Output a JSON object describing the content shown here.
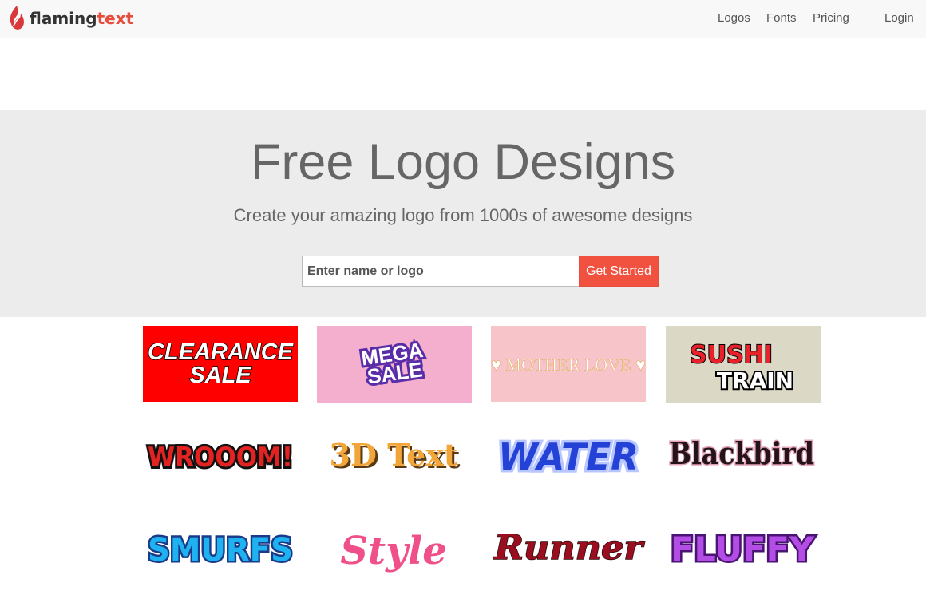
{
  "header": {
    "brand_part1": "flaming",
    "brand_part2": "text",
    "nav": [
      "Logos",
      "Fonts",
      "Pricing",
      "Login"
    ]
  },
  "hero": {
    "title": "Free Logo Designs",
    "subtitle": "Create your amazing logo from 1000s of awesome designs",
    "search_placeholder": "Enter name or logo",
    "cta_label": "Get Started"
  },
  "gallery": {
    "tiles": [
      {
        "lines": [
          "CLEARANCE",
          "SALE"
        ]
      },
      {
        "lines": [
          "MEGA",
          "SALE"
        ]
      },
      {
        "lines": [
          "♥ MOTHER LOVE ♥"
        ]
      },
      {
        "lines": [
          "SUSHI",
          "TRAIN"
        ]
      },
      {
        "lines": [
          "WROOOM!"
        ]
      },
      {
        "lines": [
          "3D Text"
        ]
      },
      {
        "lines": [
          "WATER"
        ]
      },
      {
        "lines": [
          "Blackbird"
        ]
      },
      {
        "lines": [
          "SMURFS"
        ]
      },
      {
        "lines": [
          "Style"
        ]
      },
      {
        "lines": [
          "Runner"
        ]
      },
      {
        "lines": [
          "FLUFFY"
        ]
      }
    ]
  },
  "colors": {
    "brand_red": "#e74c3c",
    "hero_background": "#ececec",
    "cta_background": "#f0523f"
  }
}
